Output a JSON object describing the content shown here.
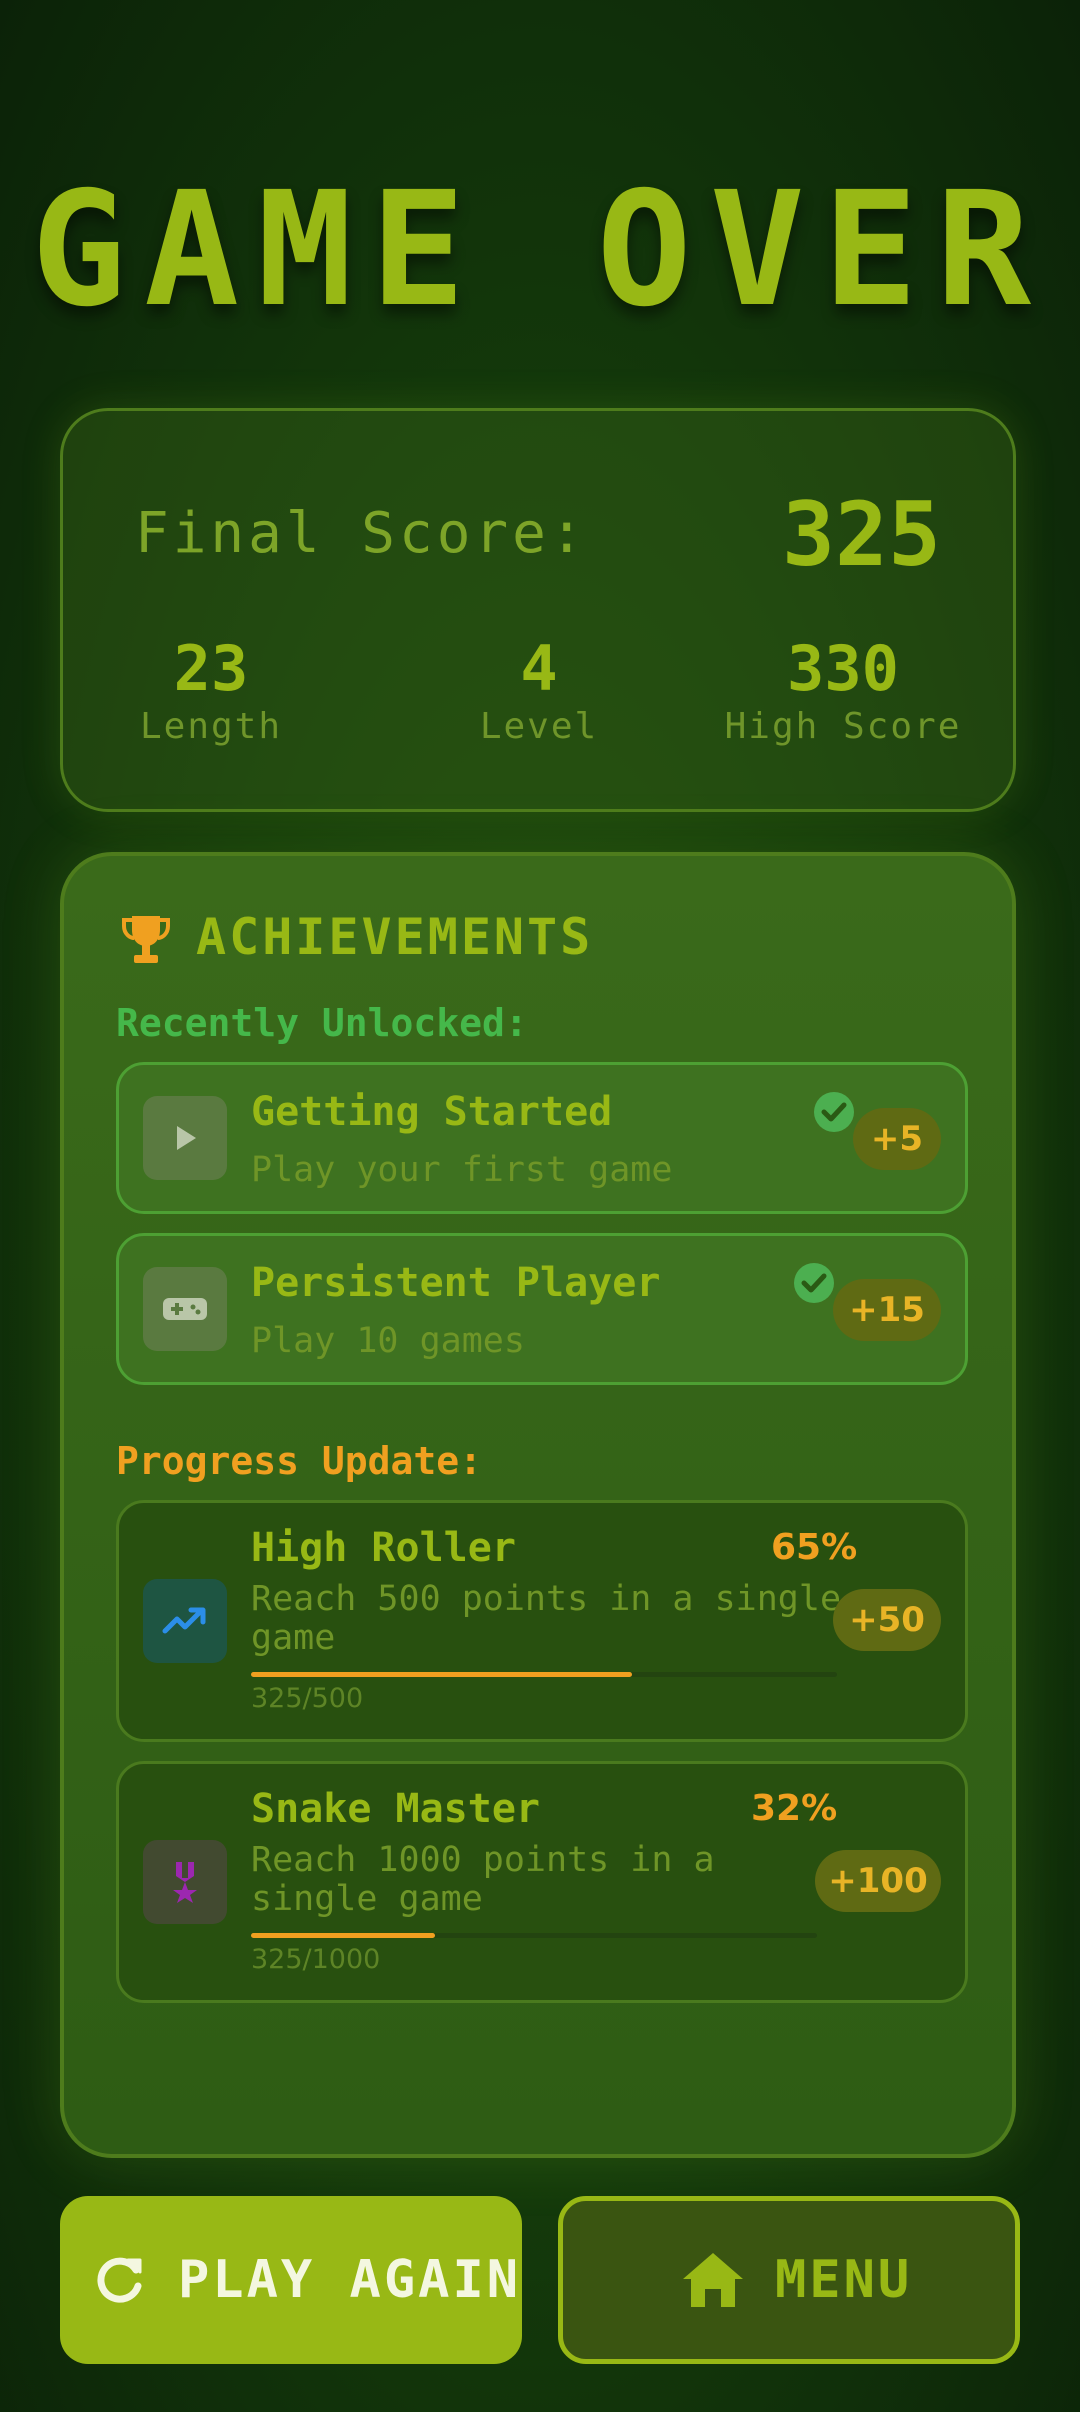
{
  "title": "GAME OVER",
  "score": {
    "final_label": "Final Score:",
    "final_value": "325",
    "stats": [
      {
        "value": "23",
        "label": "Length"
      },
      {
        "value": "4",
        "label": "Level"
      },
      {
        "value": "330",
        "label": "High Score"
      }
    ]
  },
  "achievements": {
    "title": "ACHIEVEMENTS",
    "recent_label": "Recently Unlocked:",
    "unlocked": [
      {
        "title": "Getting Started",
        "desc": "Play your first game",
        "points": "+5",
        "icon": "play-icon"
      },
      {
        "title": "Persistent Player",
        "desc": "Play 10 games",
        "points": "+15",
        "icon": "gamepad-icon"
      }
    ],
    "progress_label": "Progress Update:",
    "progress": [
      {
        "title": "High Roller",
        "desc_line1": "Reach 500 points in a single",
        "desc_line2": "game",
        "percent": "65%",
        "fraction": 0.65,
        "count": "325/500",
        "points": "+50",
        "icon": "trending-up-icon"
      },
      {
        "title": "Snake Master",
        "desc_line1": "Reach 1000 points in a",
        "desc_line2": "single game",
        "percent": "32%",
        "fraction": 0.325,
        "count": "325/1000",
        "points": "+100",
        "icon": "medal-icon"
      }
    ]
  },
  "buttons": {
    "play_again": "PLAY AGAIN",
    "menu": "MENU"
  },
  "colors": {
    "accent": "#98b815",
    "progress": "#f0a020",
    "success": "#4caf50",
    "recent_label": "#45b84a",
    "progress_label": "#f0a020",
    "points_text": "#e8b426"
  }
}
